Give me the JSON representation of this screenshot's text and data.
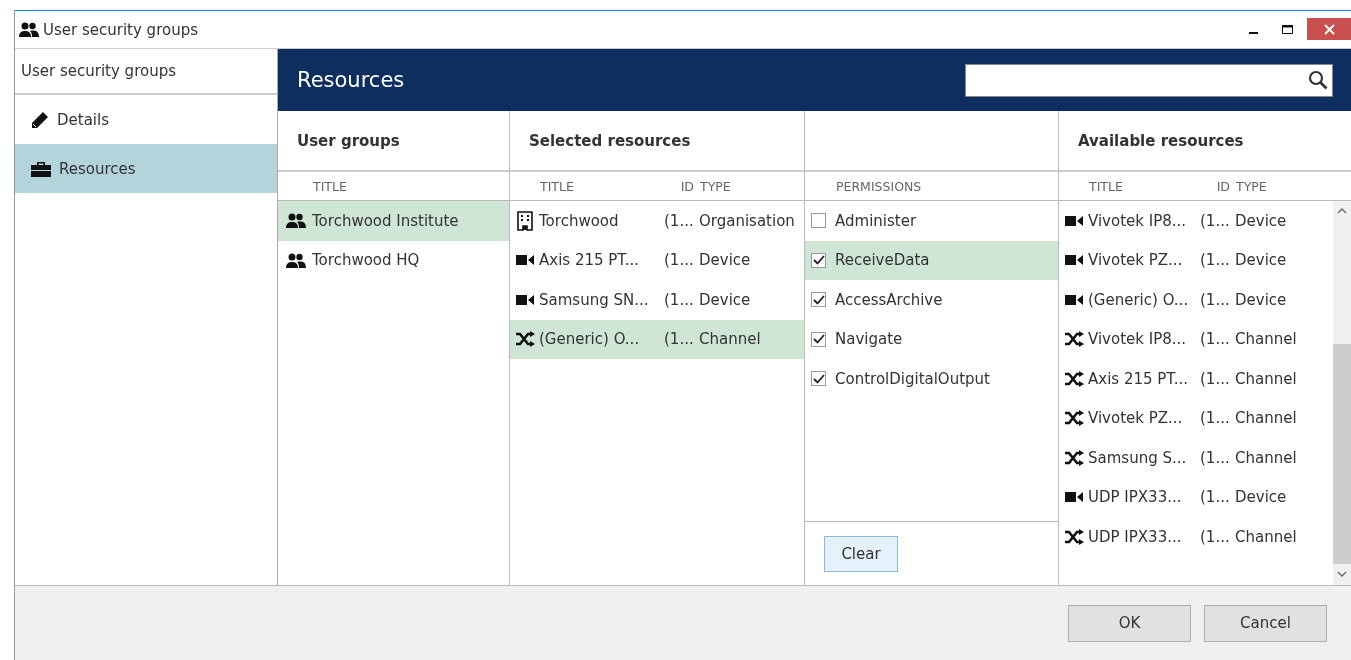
{
  "window": {
    "title": "User security groups"
  },
  "sidebar": {
    "title": "User security groups",
    "items": [
      {
        "label": "Details",
        "kind": "pencil",
        "selected": false
      },
      {
        "label": "Resources",
        "kind": "briefcase",
        "selected": true
      }
    ]
  },
  "header": {
    "title": "Resources"
  },
  "user_groups": {
    "title": "User groups",
    "columns": [
      "TITLE"
    ],
    "rows": [
      {
        "title": "Torchwood Institute",
        "selected": true
      },
      {
        "title": "Torchwood HQ",
        "selected": false
      }
    ]
  },
  "selected_resources": {
    "title": "Selected resources",
    "columns": [
      "TITLE",
      "ID",
      "TYPE"
    ],
    "rows": [
      {
        "kind": "organisation",
        "title": "Torchwood",
        "id": "(1...",
        "type": "Organisation",
        "selected": false
      },
      {
        "kind": "device",
        "title": "Axis 215 PT...",
        "id": "(1...",
        "type": "Device",
        "selected": false
      },
      {
        "kind": "device",
        "title": "Samsung SN...",
        "id": "(1...",
        "type": "Device",
        "selected": false
      },
      {
        "kind": "channel",
        "title": "(Generic) O...",
        "id": "(1...",
        "type": "Channel",
        "selected": true
      }
    ]
  },
  "permissions": {
    "columns": [
      "PERMISSIONS"
    ],
    "rows": [
      {
        "label": "Administer",
        "checked": false,
        "selected": false
      },
      {
        "label": "ReceiveData",
        "checked": true,
        "selected": true
      },
      {
        "label": "AccessArchive",
        "checked": true,
        "selected": false
      },
      {
        "label": "Navigate",
        "checked": true,
        "selected": false
      },
      {
        "label": "ControlDigitalOutput",
        "checked": true,
        "selected": false
      }
    ],
    "clear_button": "Clear"
  },
  "available_resources": {
    "title": "Available resources",
    "columns": [
      "TITLE",
      "ID",
      "TYPE"
    ],
    "rows": [
      {
        "kind": "device",
        "title": "Vivotek IP8...",
        "id": "(1...",
        "type": "Device"
      },
      {
        "kind": "device",
        "title": "Vivotek PZ...",
        "id": "(1...",
        "type": "Device"
      },
      {
        "kind": "device",
        "title": "(Generic) O...",
        "id": "(1...",
        "type": "Device"
      },
      {
        "kind": "channel",
        "title": "Vivotek IP8...",
        "id": "(1...",
        "type": "Channel"
      },
      {
        "kind": "channel",
        "title": "Axis 215 PT...",
        "id": "(1...",
        "type": "Channel"
      },
      {
        "kind": "channel",
        "title": "Vivotek PZ...",
        "id": "(1...",
        "type": "Channel"
      },
      {
        "kind": "channel",
        "title": "Samsung S...",
        "id": "(1...",
        "type": "Channel"
      },
      {
        "kind": "device",
        "title": "UDP IPX33...",
        "id": "(1...",
        "type": "Device"
      },
      {
        "kind": "channel",
        "title": "UDP IPX33...",
        "id": "(1...",
        "type": "Channel"
      }
    ]
  },
  "buttons": [
    "OK",
    "Cancel"
  ]
}
